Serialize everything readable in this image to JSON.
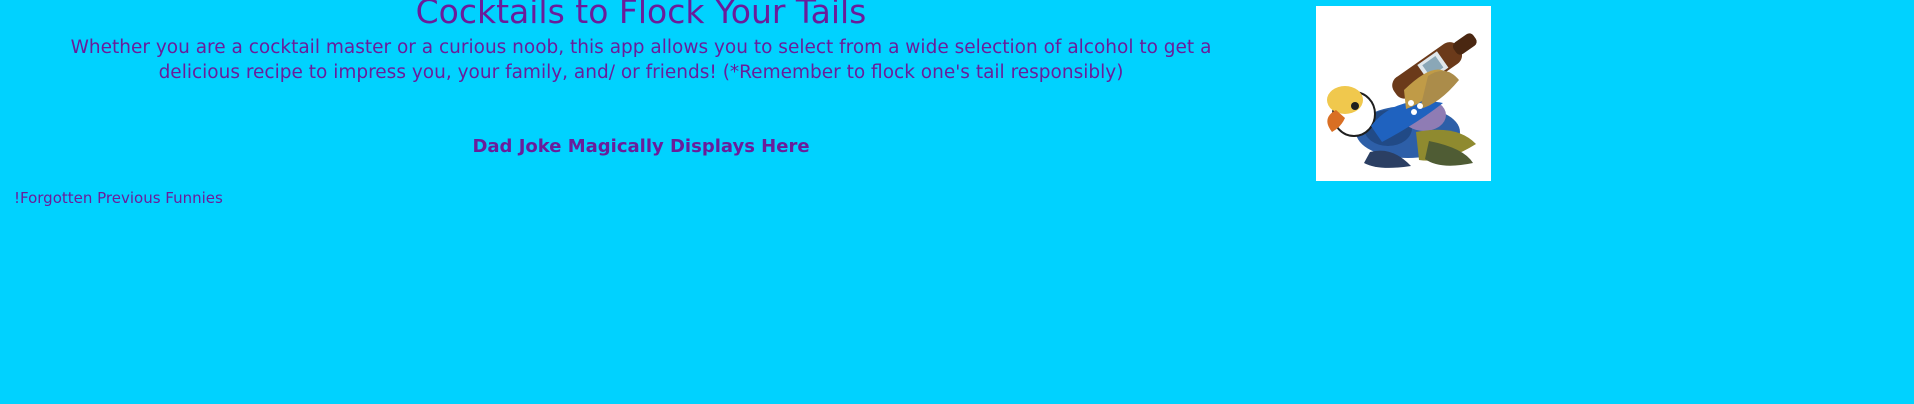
{
  "page": {
    "title": "Cocktails to Flock Your Tails",
    "description": "Whether you are a cocktail master or a curious noob, this app allows you to select from a wide selection of alcohol to get a delicious recipe to impress you, your family, and/ or friends! (*Remember to flock one's tail responsibly)",
    "joke_placeholder": "Dad Joke Magically Displays Here",
    "history_link": "!Forgotten Previous Funnies"
  },
  "theme": {
    "background": "#00d2ff",
    "text_color": "#6a1d9b"
  },
  "image": {
    "subject": "parrot-bottle-holder"
  }
}
